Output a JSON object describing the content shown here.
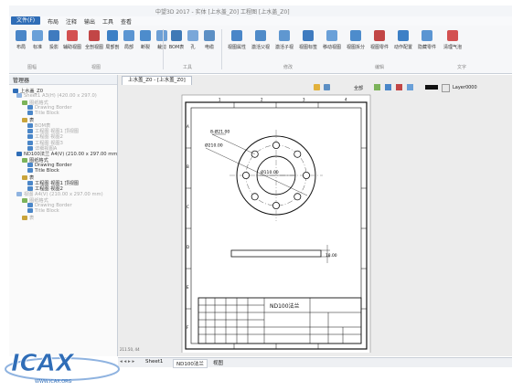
{
  "window": {
    "title": "中望3D 2017 - 实体 [上水盖_Z0] 工程图 [上水盖_Z0]"
  },
  "menu": {
    "app": "文件(F)",
    "items": [
      "布局",
      "注释",
      "输出",
      "工具",
      "查看"
    ]
  },
  "ribbon": {
    "buttons": [
      "布局",
      "标准",
      "投影",
      "辅助视图",
      "全剖视图",
      "局部剖",
      "局部",
      "断裂",
      "裁剪",
      "BOM表",
      "孔",
      "电缆",
      "视图属性",
      "激活父视",
      "激活子视",
      "视图标签",
      "移动视图",
      "视图拆分",
      "视图零件",
      "动作配置",
      "隐藏零件",
      "清理气泡"
    ],
    "groups": [
      "图幅",
      "视图",
      "工具",
      "修改",
      "编辑",
      "文字"
    ]
  },
  "panel": {
    "title": "管理器",
    "items": [
      {
        "label": "上水盖_Z0",
        "faded": false
      },
      {
        "label": "Sheet1 A3(H) (420.00 x 297.0)",
        "faded": true
      },
      {
        "label": "图纸格式",
        "faded": true
      },
      {
        "label": "Drawing Border",
        "faded": true
      },
      {
        "label": "Title Block",
        "faded": true
      },
      {
        "label": "表",
        "faded": false
      },
      {
        "label": "BOM表",
        "faded": true
      },
      {
        "label": "工程图 视图1 顶视图",
        "faded": true
      },
      {
        "label": "工程图 视图2",
        "faded": true
      },
      {
        "label": "工程图 视图3",
        "faded": true
      },
      {
        "label": "详细视图A",
        "faded": true
      },
      {
        "label": "ND100法兰 A4(V) (210.00 x 297.00 mm)",
        "faded": false
      },
      {
        "label": "图纸格式",
        "faded": false
      },
      {
        "label": "Drawing Border",
        "faded": false
      },
      {
        "label": "Title Block",
        "faded": false
      },
      {
        "label": "表",
        "faded": false
      },
      {
        "label": "工程图 视图1 顶视图",
        "faded": false
      },
      {
        "label": "工程图 视图2",
        "faded": false
      },
      {
        "label": "视图 A4(V) (210.00 x 297.00 mm)",
        "faded": true
      },
      {
        "label": "图纸格式",
        "faded": true
      },
      {
        "label": "Drawing Border",
        "faded": true
      },
      {
        "label": "Title Block",
        "faded": true
      },
      {
        "label": "表",
        "faded": true
      }
    ]
  },
  "document": {
    "tab": "上水盖_Z0 - [上水盖_Z0]",
    "toolbar": {
      "display": "全部",
      "layer": "Layer0000"
    },
    "coord": "211.50, 44"
  },
  "drawing": {
    "dim_bolt": "8-Ø21.00",
    "dim_pcd": "Ø210.00",
    "dim_bore": "Ø110.00",
    "dim_thick": "18.00",
    "title_block": "ND100法兰",
    "cols": [
      "1",
      "2",
      "3",
      "4"
    ],
    "rows": [
      "A",
      "B",
      "C",
      "D",
      "E",
      "F"
    ]
  },
  "sheettabs": [
    "Sheet1",
    "ND100法兰",
    "视图"
  ],
  "logo": {
    "text": "ICAX",
    "url": "WWW.ICAX.ORG"
  },
  "colors": {
    "accent": "#2f6db7",
    "sheet": "#ffffff",
    "line": "#111111"
  }
}
